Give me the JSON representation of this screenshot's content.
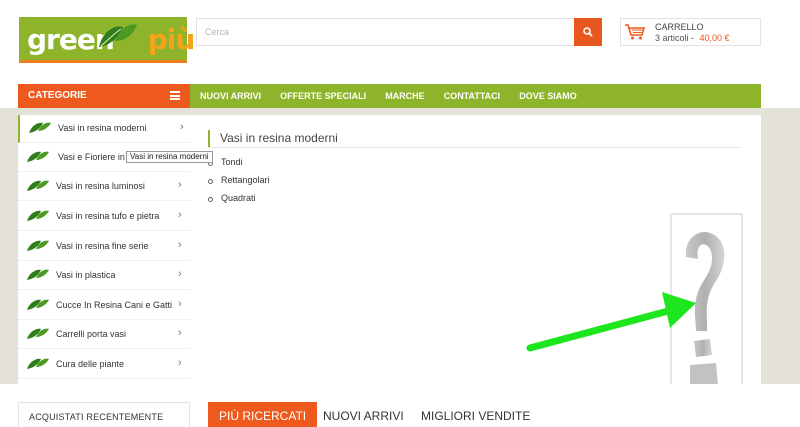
{
  "header": {
    "logo": {
      "word1": "green",
      "word2": "più"
    },
    "search": {
      "placeholder": "Cerca",
      "value": ""
    },
    "cart": {
      "title": "CARRELLO",
      "items_text": "3 articoli -",
      "total": "40,00 €"
    }
  },
  "nav": {
    "categories_label": "CATEGORIE",
    "items": [
      "NUOVI ARRIVI",
      "OFFERTE SPECIALI",
      "MARCHE",
      "CONTATTACI",
      "DOVE SIAMO"
    ]
  },
  "sidebar": {
    "items": [
      {
        "label": "Vasi in resina moderni"
      },
      {
        "label": "Vasi e Fioriere in"
      },
      {
        "label": "Vasi in resina luminosi"
      },
      {
        "label": "Vasi in resina tufo e pietra"
      },
      {
        "label": "Vasi in resina fine serie"
      },
      {
        "label": "Vasi in plastica"
      },
      {
        "label": "Cucce In Resina Cani e Gatti"
      },
      {
        "label": "Carrelli porta vasi"
      },
      {
        "label": "Cura delle piante"
      }
    ],
    "tooltip": "Vasi in resina moderni"
  },
  "main": {
    "title": "Vasi in resina moderni",
    "subcategories": [
      "Tondi",
      "Rettangolari",
      "Quadrati"
    ]
  },
  "bottom": {
    "recent_label": "ACQUISTATI RECENTEMENTE",
    "tabs": [
      "PIÙ RICERCATI",
      "NUOVI ARRIVI",
      "MIGLIORI VENDITE"
    ]
  },
  "colors": {
    "brand_green": "#8db42a",
    "brand_orange": "#ee5a1d",
    "arrow_green": "#1ee61e"
  },
  "icons": [
    "leaf-icon",
    "search-icon",
    "cart-icon",
    "menu-icon",
    "chevron-right-icon",
    "question-mark-icon",
    "arrow-icon"
  ]
}
